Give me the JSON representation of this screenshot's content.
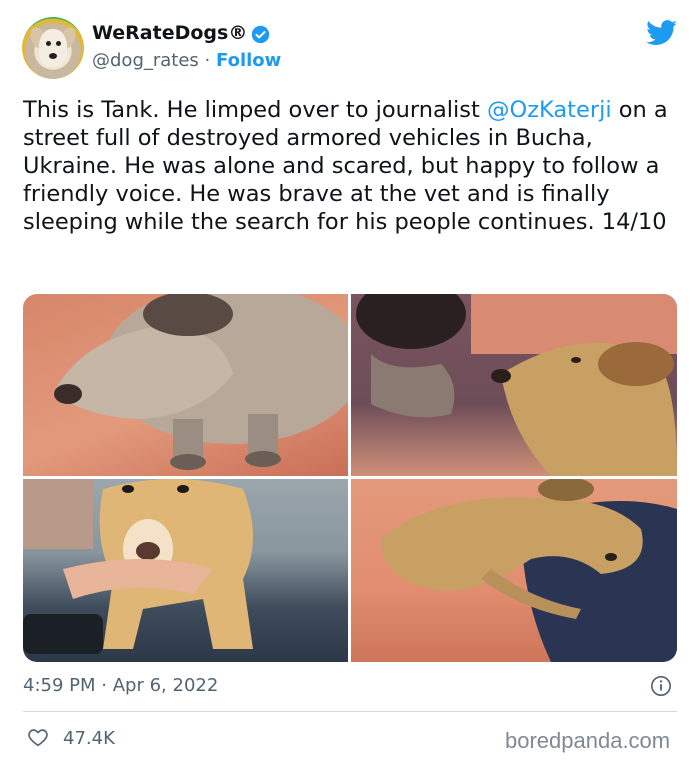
{
  "author": {
    "name": "WeRateDogs®",
    "handle": "@dog_rates",
    "separator": "·",
    "follow_label": "Follow"
  },
  "icons": {
    "avatar": "dog-avatar",
    "verified": "verified-badge-icon",
    "brand": "twitter-bird-icon",
    "info": "info-icon",
    "like": "heart-icon"
  },
  "colors": {
    "accent": "#1d9bf0",
    "text": "#0f1419",
    "muted": "#536471"
  },
  "tweet": {
    "text_before_mention": "This is Tank. He limped over to journalist ",
    "mention": "@OzKaterji",
    "text_after_mention": " on a street full of destroyed armored vehicles in Bucha, Ukraine. He was alone and scared, but happy to follow a friendly voice. He was brave at the vet and is finally sleeping while the search for his people continues. 14/10"
  },
  "photos": [
    {
      "alt": "dog standing on couch, close-up of face"
    },
    {
      "alt": "dog resting head on man's shoulder"
    },
    {
      "alt": "dog being held on vet table"
    },
    {
      "alt": "dog sleeping curled on blanket"
    }
  ],
  "meta": {
    "time": "4:59 PM",
    "separator": "·",
    "date": "Apr 6, 2022"
  },
  "stats": {
    "likes": "47.4K"
  },
  "watermark": "boredpanda.com"
}
